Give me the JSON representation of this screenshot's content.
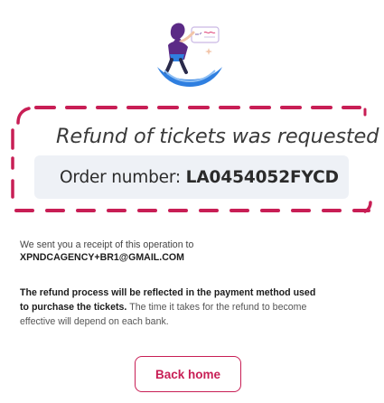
{
  "confirmation": {
    "title": "Refund of tickets was requested",
    "order_label": "Order number:",
    "order_number": "LA0454052FYCD",
    "receipt_text": "We sent you a receipt of this operation to",
    "receipt_email": "XPNDCAGENCY+BR1@GMAIL.COM",
    "refund_process_bold": "The refund process will be reflected in the payment method used to purchase the tickets.",
    "refund_process_rest": "The time it takes for the refund to become effective will depend on each bank.",
    "back_button_label": "Back home"
  },
  "colors": {
    "accent": "#c81e55",
    "order_box_bg": "#eef1f6",
    "illustration_blue": "#2f7fe0",
    "illustration_purple": "#5b2a86"
  },
  "icons": {
    "illustration": "person-with-ticket-illustration"
  }
}
